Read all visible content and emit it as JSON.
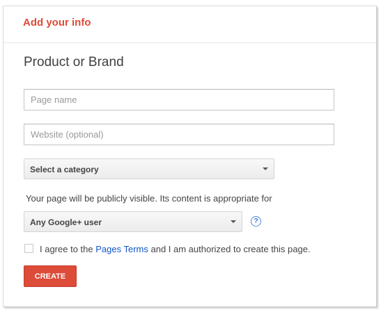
{
  "header": {
    "title": "Add your info"
  },
  "form": {
    "section_title": "Product or Brand",
    "page_name": {
      "value": "",
      "placeholder": "Page name"
    },
    "website": {
      "value": "",
      "placeholder": "Website (optional)"
    },
    "category": {
      "selected": "Select a category"
    },
    "visibility_text": "Your page will be publicly visible. Its content is appropriate for",
    "audience": {
      "selected": "Any Google+ user"
    },
    "help_icon_glyph": "?",
    "terms": {
      "checked": false,
      "prefix": "I agree to the ",
      "link_label": "Pages Terms",
      "suffix": " and I am authorized to create this page."
    },
    "create_label": "CREATE"
  },
  "colors": {
    "accent": "#dd4b39",
    "link": "#1155cc"
  },
  "icons": {
    "help": "help-icon",
    "dropdown": "chevron-down-icon"
  }
}
